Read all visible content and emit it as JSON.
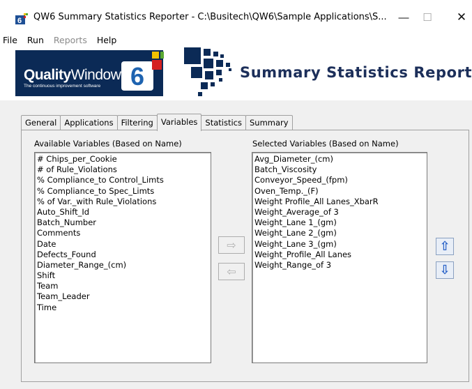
{
  "window": {
    "title": "QW6 Summary Statistics Reporter - C:\\Busitech\\QW6\\Sample Applications\\S...",
    "minimize_glyph": "—",
    "maximize_glyph": "☐",
    "close_glyph": "✕"
  },
  "menu": {
    "items": [
      "File",
      "Run",
      "Reports",
      "Help"
    ]
  },
  "banner": {
    "logo_quality": "Quality",
    "logo_window": "Window",
    "logo_tagline": "The continuous improvement software",
    "logo_version": "6",
    "title": "Summary Statistics Reporter"
  },
  "tabs": [
    "General",
    "Applications",
    "Filtering",
    "Variables",
    "Statistics",
    "Summary"
  ],
  "active_tab": "Variables",
  "available": {
    "label": "Available Variables (Based on Name)",
    "items": [
      "# Chips_per_Cookie",
      "# of Rule_Violations",
      "% Compliance_to Control_Limts",
      "% Compliance_to Spec_Limts",
      "% of Var._with Rule_Violations",
      "Auto_Shift_Id",
      "Batch_Number",
      "Comments",
      "Date",
      "Defects_Found",
      "Diameter_Range_(cm)",
      "Shift",
      "Team",
      "Team_Leader",
      "Time"
    ]
  },
  "selected": {
    "label": "Selected Variables (Based on Name)",
    "items": [
      "Avg_Diameter_(cm)",
      "Batch_Viscosity",
      "Conveyor_Speed_(fpm)",
      "Oven_Temp._(F)",
      "Weight Profile_All Lanes_XbarR",
      "Weight_Average_of 3",
      "Weight_Lane 1_(gm)",
      "Weight_Lane 2_(gm)",
      "Weight_Lane 3_(gm)",
      "Weight_Profile_All Lanes",
      "Weight_Range_of 3"
    ]
  },
  "buttons": {
    "add_glyph": "⇨",
    "remove_glyph": "⇦",
    "up_glyph": "⇧",
    "down_glyph": "⇩"
  },
  "colors": {
    "banner_navy": "#0b2a56",
    "accent_blue": "#2a63c8",
    "logo_yellow": "#f2c200",
    "logo_green": "#5aa832",
    "logo_red": "#d42020"
  }
}
